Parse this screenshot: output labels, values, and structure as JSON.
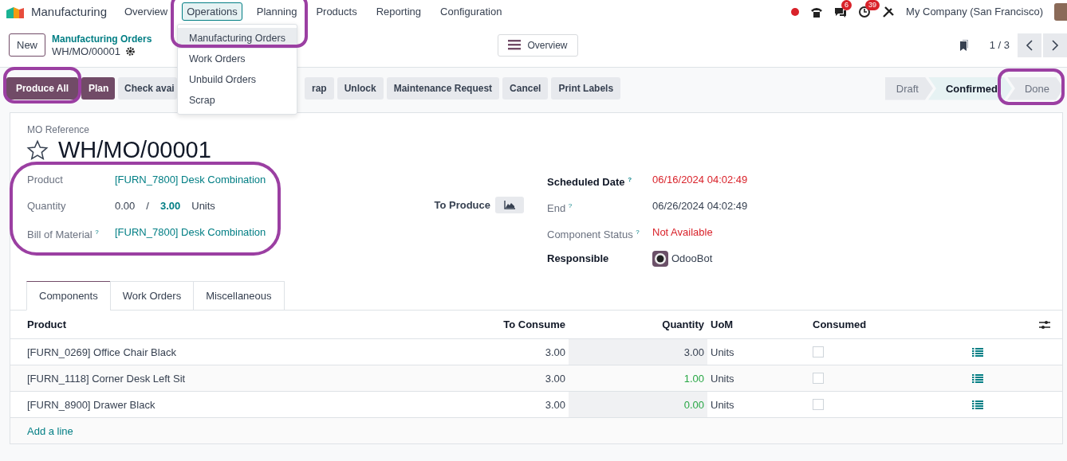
{
  "navbar": {
    "app": "Manufacturing",
    "menu": [
      {
        "label": "Overview",
        "selected": false
      },
      {
        "label": "Operations",
        "selected": true
      },
      {
        "label": "Planning",
        "selected": false
      },
      {
        "label": "Products",
        "selected": false
      },
      {
        "label": "Reporting",
        "selected": false
      },
      {
        "label": "Configuration",
        "selected": false
      }
    ],
    "messages_badge": "6",
    "activities_badge": "39",
    "company": "My Company (San Francisco)"
  },
  "operations_menu": [
    {
      "label": "Manufacturing Orders",
      "selected": true
    },
    {
      "label": "Work Orders",
      "selected": false
    },
    {
      "label": "Unbuild Orders",
      "selected": false
    },
    {
      "label": "Scrap",
      "selected": false
    }
  ],
  "control_panel": {
    "new_button": "New",
    "breadcrumb": "Manufacturing Orders",
    "record": "WH/MO/00001",
    "overview_button": "Overview",
    "pager": "1 / 3"
  },
  "actions": [
    {
      "label": "Produce All",
      "kind": "primary"
    },
    {
      "label": "Plan",
      "kind": "primary"
    },
    {
      "label": "Check avai",
      "kind": "secondary"
    },
    {
      "label": "rap",
      "kind": "secondary"
    },
    {
      "label": "Unlock",
      "kind": "secondary"
    },
    {
      "label": "Maintenance Request",
      "kind": "secondary"
    },
    {
      "label": "Cancel",
      "kind": "secondary"
    },
    {
      "label": "Print Labels",
      "kind": "secondary"
    }
  ],
  "stages": [
    {
      "label": "Draft",
      "selected": false
    },
    {
      "label": "Confirmed",
      "selected": true
    },
    {
      "label": "Done",
      "selected": false
    }
  ],
  "form": {
    "reference_label": "MO Reference",
    "reference": "WH/MO/00001",
    "favorite": false,
    "product_label": "Product",
    "product": "[FURN_7800] Desk Combination",
    "quantity_label": "Quantity",
    "quantity_produced": "0.00",
    "quantity_separator": "/",
    "quantity": "3.00",
    "quantity_uom": "Units",
    "bom_label": "Bill of Material",
    "bom_help": "?",
    "bom": "[FURN_7800] Desk Combination",
    "to_produce_label": "To Produce",
    "scheduled_label": "Scheduled Date",
    "scheduled_help": "?",
    "scheduled": "06/16/2024 04:02:49",
    "end_label": "End",
    "end_help": "?",
    "end": "06/26/2024 04:02:49",
    "status_label": "Component Status",
    "status_help": "?",
    "status": "Not Available",
    "responsible_label": "Responsible",
    "responsible": "OdooBot"
  },
  "tabs": [
    {
      "label": "Components",
      "selected": true
    },
    {
      "label": "Work Orders",
      "selected": false
    },
    {
      "label": "Miscellaneous",
      "selected": false
    }
  ],
  "table": {
    "columns": [
      "Product",
      "To Consume",
      "Quantity",
      "UoM",
      "Consumed"
    ],
    "rows": [
      {
        "product": "[FURN_0269] Office Chair Black",
        "to_consume": "3.00",
        "quantity": "3.00",
        "color": "#374151",
        "uom": "Units",
        "consumed": false
      },
      {
        "product": "[FURN_1118] Corner Desk Left Sit",
        "to_consume": "3.00",
        "quantity": "1.00",
        "color": "#28a745",
        "uom": "Units",
        "consumed": false
      },
      {
        "product": "[FURN_8900] Drawer Black",
        "to_consume": "3.00",
        "quantity": "0.00",
        "color": "#28a745",
        "uom": "Units",
        "consumed": false
      }
    ],
    "add_line": "Add a line"
  }
}
